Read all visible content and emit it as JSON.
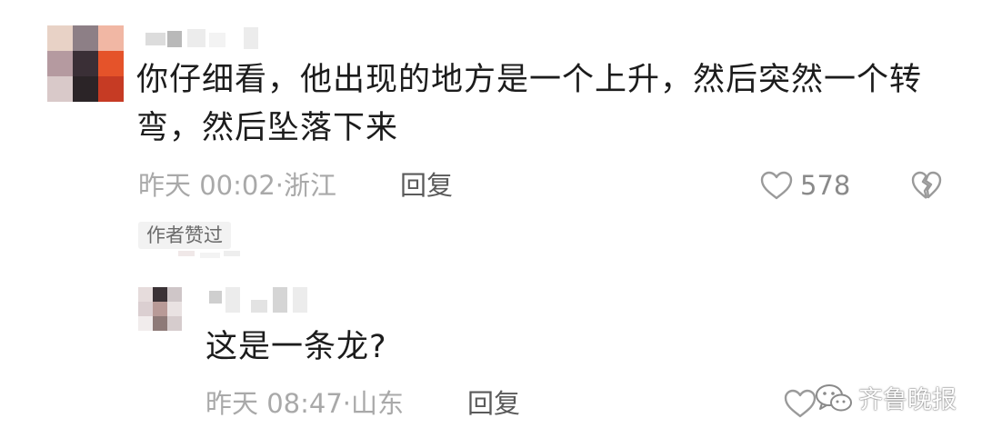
{
  "comments": [
    {
      "text": "你仔细看，他出现的地方是一个上升，然后突然一个转弯，然后坠落下来",
      "time": "昨天 00:02",
      "separator": "·",
      "location": "浙江",
      "reply_label": "回复",
      "likes": "578",
      "badge": "作者赞过"
    }
  ],
  "replies": [
    {
      "text": "这是一条龙?",
      "time": "昨天 08:47",
      "separator": "·",
      "location": "山东",
      "reply_label": "回复"
    }
  ],
  "watermark": {
    "text": "齐鲁晚报",
    "icon": "wechat-icon"
  },
  "icons": {
    "like": "heart-outline-icon",
    "dislike": "broken-heart-icon"
  },
  "colors": {
    "text": "#1c1c1c",
    "meta": "#a9a9a9",
    "reply": "#5a5a5a",
    "badge_bg": "#f2f2f2"
  }
}
